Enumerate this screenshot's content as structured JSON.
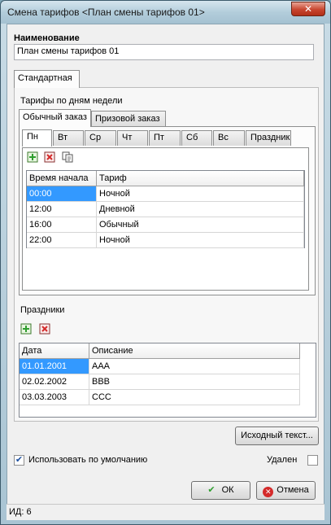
{
  "window": {
    "title": "Смена тарифов <План смены тарифов 01>",
    "close_glyph": "✕"
  },
  "name_section": {
    "label": "Наименование",
    "value": "План смены тарифов 01"
  },
  "outer_tabs": [
    {
      "label": "Стандартная",
      "active": true
    }
  ],
  "weekday_group": {
    "label": "Тарифы по дням недели",
    "order_tabs": [
      {
        "label": "Обычный заказ",
        "active": true
      },
      {
        "label": "Призовой заказ",
        "active": false
      }
    ],
    "day_tabs": [
      "Пн",
      "Вт",
      "Ср",
      "Чт",
      "Пт",
      "Сб",
      "Вс",
      "Праздник"
    ],
    "toolbar": {
      "add_icon": "add-icon",
      "delete_icon": "delete-icon",
      "copy_icon": "copy-icon"
    },
    "table": {
      "columns": [
        "Время начала",
        "Тариф"
      ],
      "rows": [
        {
          "time": "00:00",
          "tariff": "Ночной",
          "selected": true
        },
        {
          "time": "12:00",
          "tariff": "Дневной",
          "selected": false
        },
        {
          "time": "16:00",
          "tariff": "Обычный",
          "selected": false
        },
        {
          "time": "22:00",
          "tariff": "Ночной",
          "selected": false
        }
      ]
    }
  },
  "holidays": {
    "label": "Праздники",
    "table": {
      "columns": [
        "Дата",
        "Описание"
      ],
      "rows": [
        {
          "date": "01.01.2001",
          "desc": "AAA",
          "selected": true
        },
        {
          "date": "02.02.2002",
          "desc": "BBB",
          "selected": false
        },
        {
          "date": "03.03.2003",
          "desc": "CCC",
          "selected": false
        }
      ]
    }
  },
  "source_button": "Исходный текст...",
  "use_default": {
    "label": "Использовать по умолчанию",
    "checked": true
  },
  "deleted": {
    "label": "Удален",
    "checked": false
  },
  "buttons": {
    "ok": "ОК",
    "cancel": "Отмена"
  },
  "status": "ИД: 6",
  "colors": {
    "selection": "#3399ff",
    "add": "#2e9e2e",
    "delete": "#d42a2a"
  }
}
